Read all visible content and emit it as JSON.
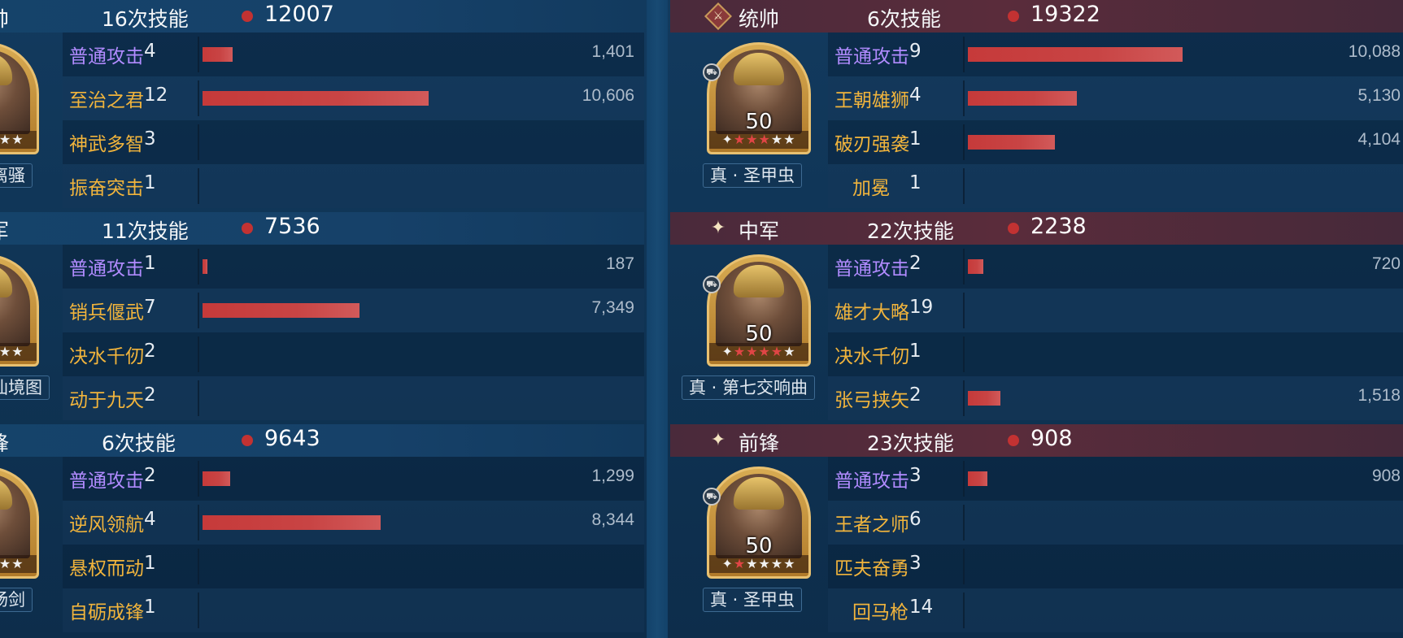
{
  "left": [
    {
      "role": "帅",
      "skill_count": "16次技能",
      "total": "12007",
      "level": "0",
      "stars": [
        "white",
        "white",
        "white",
        "white",
        "white",
        "white"
      ],
      "treasure": "离骚",
      "skills": [
        {
          "name": "普通攻击",
          "times": "4",
          "damage": "1,401",
          "ratio": 0.132,
          "normal": true
        },
        {
          "name": "至治之君",
          "times": "12",
          "damage": "10,606",
          "ratio": 1.0,
          "normal": false
        },
        {
          "name": "神武多智",
          "times": "3",
          "damage": "",
          "ratio": 0,
          "normal": false
        },
        {
          "name": "振奋突击",
          "times": "1",
          "damage": "",
          "ratio": 0,
          "normal": false
        }
      ]
    },
    {
      "role": "军",
      "skill_count": "11次技能",
      "total": "7536",
      "level": "0",
      "stars": [
        "white",
        "white",
        "white",
        "white",
        "white",
        "white"
      ],
      "treasure": "仙境图",
      "skills": [
        {
          "name": "普通攻击",
          "times": "1",
          "damage": "187",
          "ratio": 0.018,
          "normal": true
        },
        {
          "name": "销兵偃武",
          "times": "7",
          "damage": "7,349",
          "ratio": 0.693,
          "normal": false
        },
        {
          "name": "决水千仞",
          "times": "2",
          "damage": "",
          "ratio": 0,
          "normal": false
        },
        {
          "name": "动于九天",
          "times": "2",
          "damage": "",
          "ratio": 0,
          "normal": false
        }
      ]
    },
    {
      "role": "锋",
      "skill_count": "6次技能",
      "total": "9643",
      "level": "0",
      "stars": [
        "white",
        "white",
        "white",
        "white",
        "white",
        "white"
      ],
      "treasure": "肠剑",
      "skills": [
        {
          "name": "普通攻击",
          "times": "2",
          "damage": "1,299",
          "ratio": 0.122,
          "normal": true
        },
        {
          "name": "逆风领航",
          "times": "4",
          "damage": "8,344",
          "ratio": 0.787,
          "normal": false
        },
        {
          "name": "悬权而动",
          "times": "1",
          "damage": "",
          "ratio": 0,
          "normal": false
        },
        {
          "name": "自砺成锋",
          "times": "1",
          "damage": "",
          "ratio": 0,
          "normal": false
        }
      ]
    }
  ],
  "right": [
    {
      "icon": "commander-badge-icon",
      "role": "统帅",
      "skill_count": "6次技能",
      "total": "19322",
      "level": "50",
      "stars": [
        "white",
        "red",
        "red",
        "red",
        "white",
        "white"
      ],
      "treasure": "真 · 圣甲虫",
      "skills": [
        {
          "name": "普通攻击",
          "times": "9",
          "damage": "10,088",
          "ratio": 0.972,
          "normal": true
        },
        {
          "name": "王朝雄狮",
          "times": "4",
          "damage": "5,130",
          "ratio": 0.494,
          "normal": false
        },
        {
          "name": "破刃强袭",
          "times": "1",
          "damage": "4,104",
          "ratio": 0.395,
          "normal": false
        },
        {
          "name": "加冕",
          "times": "1",
          "damage": "",
          "ratio": 0,
          "normal": false,
          "narrow": true
        }
      ]
    },
    {
      "icon": "sparkle-icon",
      "role": "中军",
      "skill_count": "22次技能",
      "total": "2238",
      "level": "50",
      "stars": [
        "white",
        "red",
        "red",
        "red",
        "red",
        "white"
      ],
      "treasure": "真 · 第七交响曲",
      "skills": [
        {
          "name": "普通攻击",
          "times": "2",
          "damage": "720",
          "ratio": 0.069,
          "normal": true
        },
        {
          "name": "雄才大略",
          "times": "19",
          "damage": "",
          "ratio": 0,
          "normal": false
        },
        {
          "name": "决水千仞",
          "times": "1",
          "damage": "",
          "ratio": 0,
          "normal": false
        },
        {
          "name": "张弓挟矢",
          "times": "2",
          "damage": "1,518",
          "ratio": 0.146,
          "normal": false
        }
      ]
    },
    {
      "icon": "sparkle-icon",
      "role": "前锋",
      "skill_count": "23次技能",
      "total": "908",
      "level": "50",
      "stars": [
        "white",
        "red",
        "white",
        "white",
        "white",
        "white"
      ],
      "treasure": "真 · 圣甲虫",
      "skills": [
        {
          "name": "普通攻击",
          "times": "3",
          "damage": "908",
          "ratio": 0.087,
          "normal": true
        },
        {
          "name": "王者之师",
          "times": "6",
          "damage": "",
          "ratio": 0,
          "normal": false
        },
        {
          "name": "匹夫奋勇",
          "times": "3",
          "damage": "",
          "ratio": 0,
          "normal": false
        },
        {
          "name": "回马枪",
          "times": "14",
          "damage": "",
          "ratio": 0,
          "normal": false,
          "narrow": true
        }
      ]
    }
  ],
  "colors": {
    "skill_name": "#f1b43c",
    "normal_attack": "#b18bff",
    "bar": "#c63a3a",
    "dot": "#c23232",
    "left_header": "#15436a",
    "right_header": "#5a2c3b"
  }
}
